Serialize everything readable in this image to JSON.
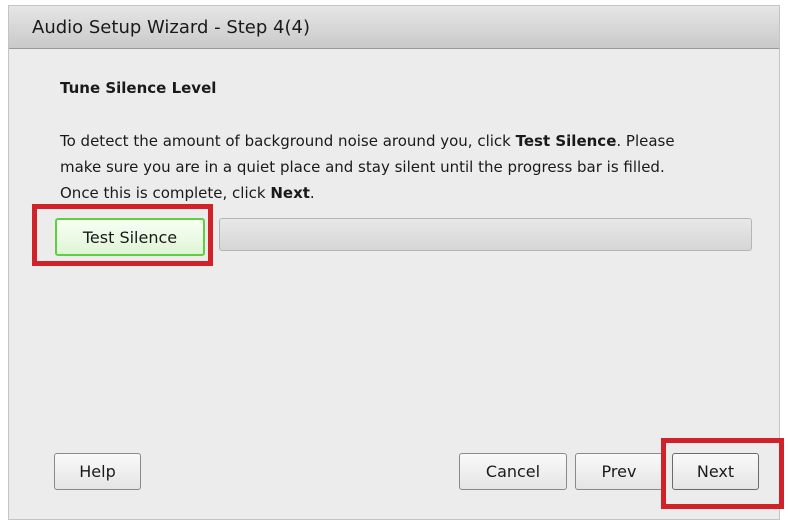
{
  "window": {
    "title": "Audio Setup Wizard - Step 4(4)"
  },
  "section": {
    "title": "Tune Silence Level"
  },
  "instructions": {
    "line1_pre": "To detect the amount of background noise around you, click ",
    "line1_bold": "Test Silence",
    "line1_post": ". Please",
    "line2": "make sure you are in a quiet place and stay silent until the progress bar is filled.",
    "line3_pre": "Once this is complete, click ",
    "line3_bold": "Next",
    "line3_post": "."
  },
  "test_button": {
    "label": "Test Silence"
  },
  "progress": {
    "value_percent": 0
  },
  "buttons": {
    "help": "Help",
    "cancel": "Cancel",
    "prev": "Prev",
    "next": "Next"
  },
  "colors": {
    "highlight": "#d1222a",
    "test_button_border": "#5fcf3f"
  }
}
